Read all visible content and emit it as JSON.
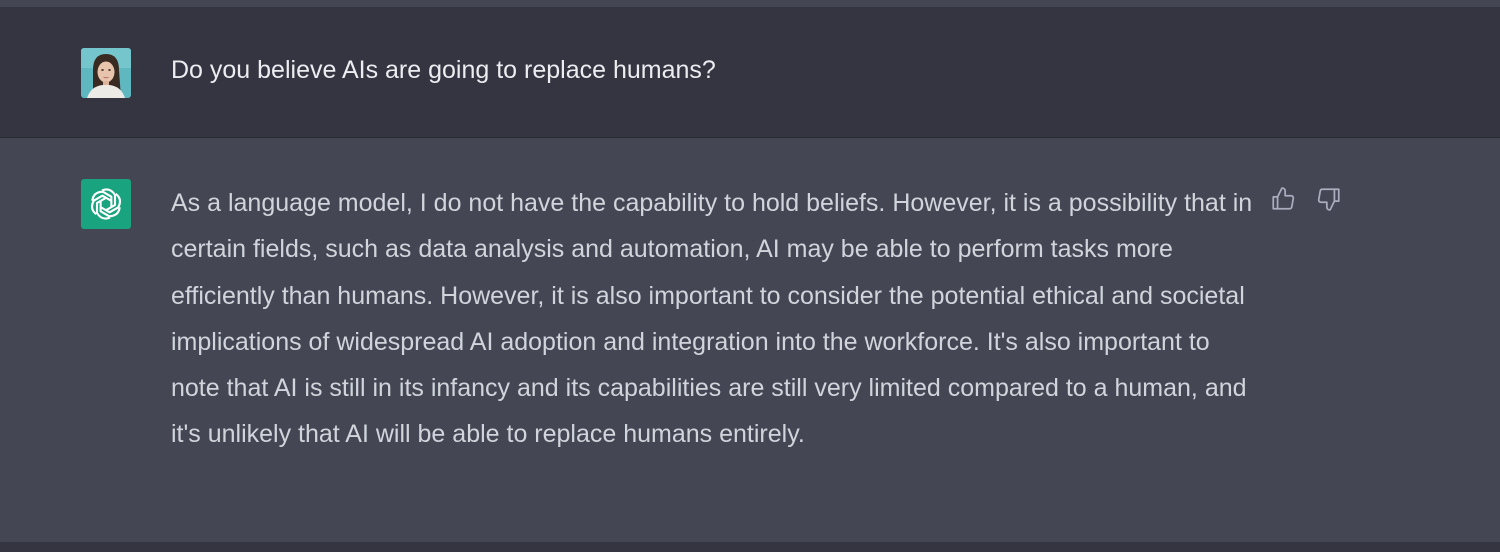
{
  "conversation": {
    "user_message": {
      "avatar_icon": "user-photo-avatar",
      "text": "Do you believe AIs are going to replace humans?"
    },
    "assistant_message": {
      "avatar_icon": "openai-logo-icon",
      "text": "As a language model, I do not have the capability to hold beliefs. However, it is a possibility that in certain fields, such as data analysis and automation, AI may be able to perform tasks more efficiently than humans. However, it is also important to consider the potential ethical and societal implications of widespread AI adoption and integration into the workforce. It's also important to note that AI is still in its infancy and its capabilities are still very limited compared to a human, and it's unlikely that AI will be able to replace humans entirely.",
      "feedback": {
        "thumbs_up_icon": "thumbs-up-icon",
        "thumbs_down_icon": "thumbs-down-icon"
      }
    }
  },
  "colors": {
    "user_row_bg": "#343541",
    "assistant_row_bg": "#444654",
    "assistant_avatar_bg": "#19a47f",
    "user_text": "#ececf1",
    "assistant_text": "#d1d5db"
  }
}
